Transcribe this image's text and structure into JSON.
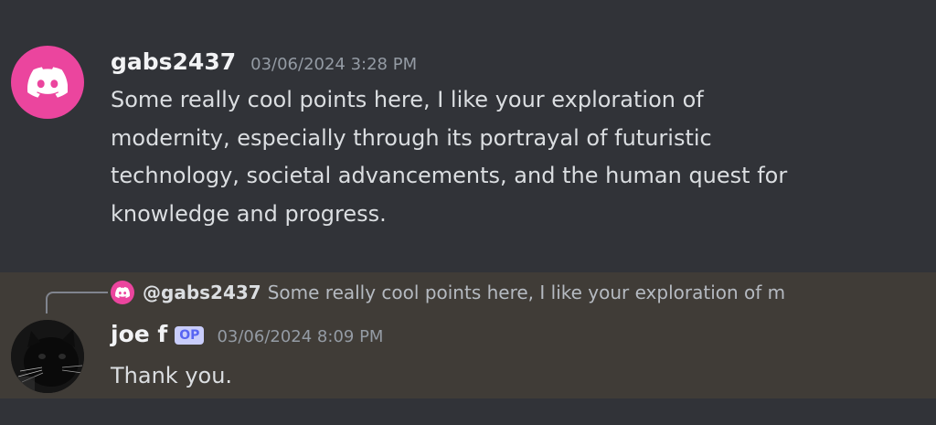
{
  "messages": [
    {
      "username": "gabs2437",
      "timestamp": "03/06/2024 3:28 PM",
      "avatar_icon": "discord-logo-icon",
      "avatar_color": "#eb459e",
      "content": "Some really cool points here, I like your exploration of modernity, especially through its portrayal of futuristic technology, societal advancements, and the human quest for knowledge and progress."
    },
    {
      "username": "joe f",
      "badge": "OP",
      "timestamp": "03/06/2024 8:09 PM",
      "avatar_icon": "black-cat-avatar",
      "content": "Thank you.",
      "reply": {
        "username": "@gabs2437",
        "preview": "Some really cool points here, I like your exploration of m"
      }
    }
  ],
  "colors": {
    "background": "#313338",
    "highlight_background": "#403c37",
    "badge_background": "#c9cdfb",
    "badge_text": "#5865f2"
  }
}
